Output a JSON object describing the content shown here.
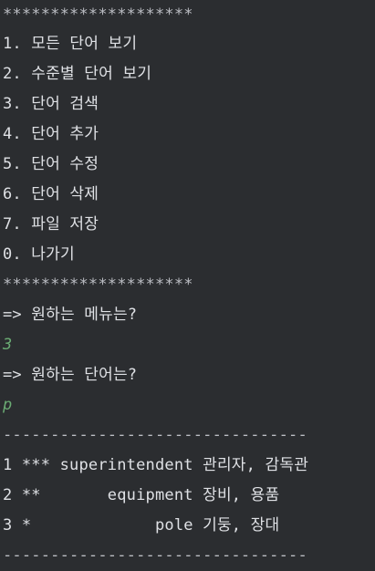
{
  "console": {
    "separator_stars": "********************",
    "menu": [
      "1. 모든 단어 보기",
      "2. 수준별 단어 보기",
      "3. 단어 검색",
      "4. 단어 추가",
      "5. 단어 수정",
      "6. 단어 삭제",
      "7. 파일 저장",
      "0. 나가기"
    ],
    "prompt_menu": "=> 원하는 메뉴는?",
    "input_menu": "3",
    "prompt_word": "=> 원하는 단어는?",
    "input_word": "p",
    "separator_dashes": "--------------------------------",
    "results": [
      "1 *** superintendent 관리자, 감독관",
      "2 **       equipment 장비, 용품",
      "3 *             pole 기둥, 장대"
    ]
  },
  "colors": {
    "background": "#2b2d30",
    "text": "#dfe1e5",
    "user_input": "#6aab73"
  }
}
